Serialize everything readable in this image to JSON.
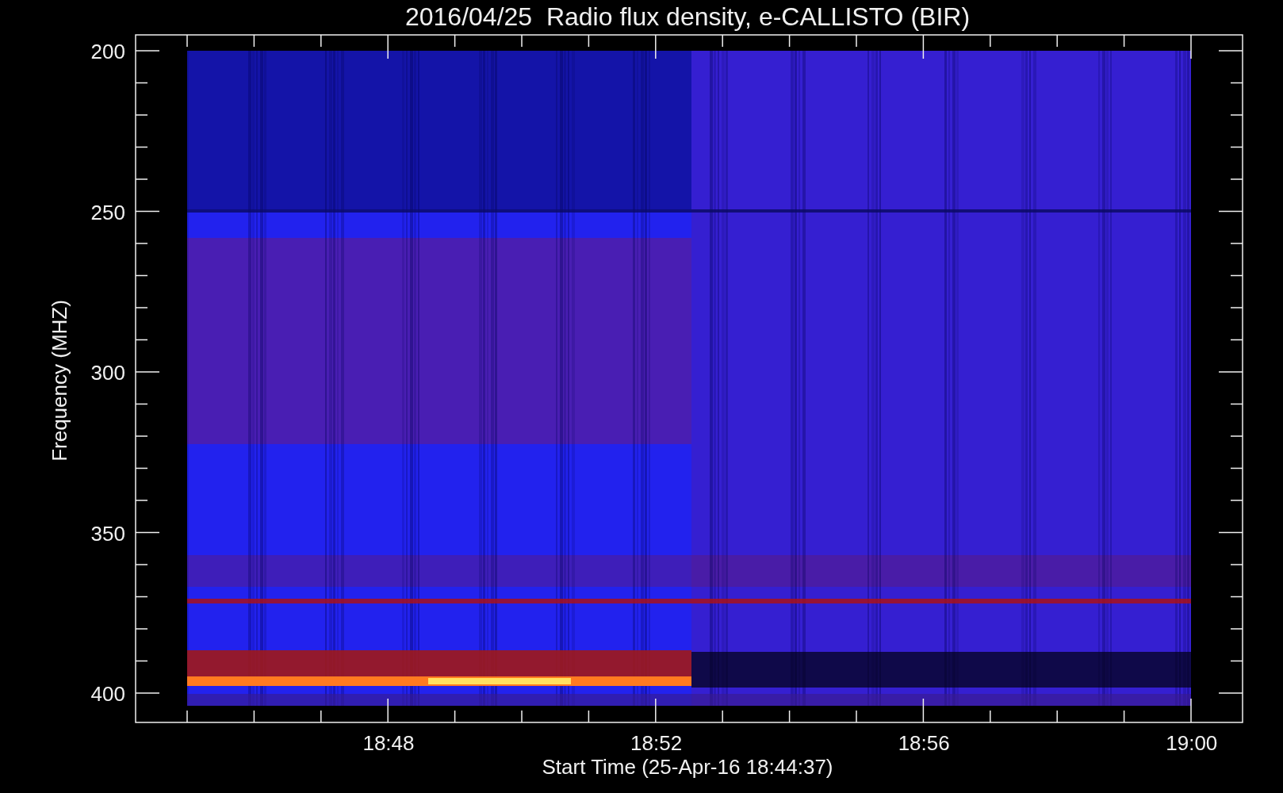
{
  "plot": {
    "title": "2016/04/25  Radio flux density, e-CALLISTO (BIR)",
    "ylabel": "Frequency (MHZ)",
    "xlabel": "Start Time (25-Apr-16 18:44:37)",
    "yticks": [
      "200",
      "250",
      "300",
      "350",
      "400"
    ],
    "xticks": [
      "18:48",
      "18:52",
      "18:56",
      "19:00"
    ]
  }
}
